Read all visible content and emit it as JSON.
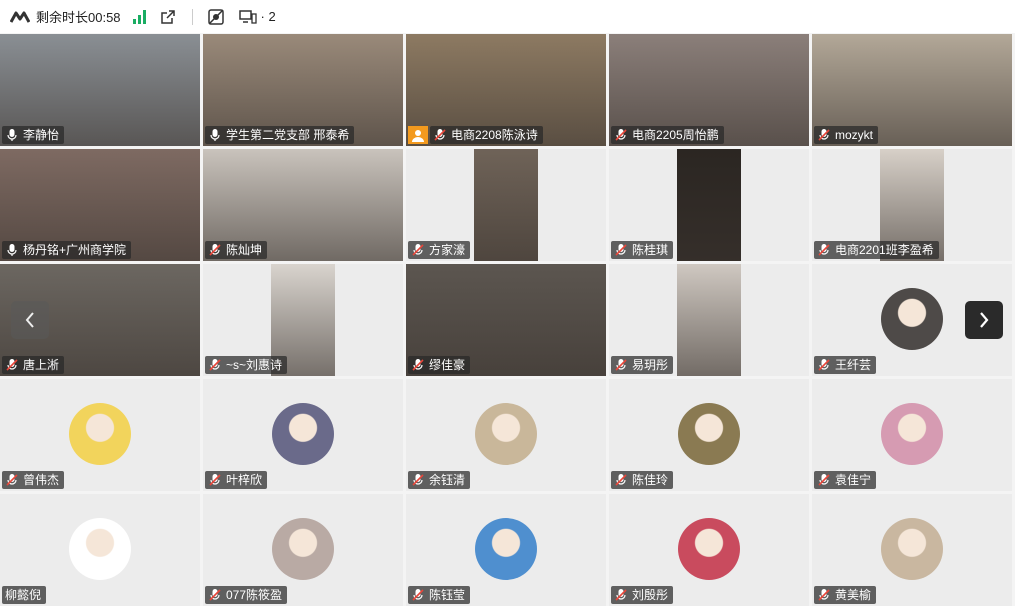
{
  "topbar": {
    "remaining": "剩余时长00:58",
    "device_count": "· 2"
  },
  "participants": [
    {
      "name": "李静怡",
      "mic": "on",
      "kind": "video",
      "bg": "#8a8f94"
    },
    {
      "name": "学生第二党支部 邢泰希",
      "mic": "on",
      "kind": "video",
      "bg": "#9a8a7a"
    },
    {
      "name": "电商2208陈泳诗",
      "mic": "off",
      "kind": "video",
      "bg": "#8d7a62",
      "badge": "host"
    },
    {
      "name": "电商2205周怡鹏",
      "mic": "off",
      "kind": "video",
      "bg": "#8b7f7a"
    },
    {
      "name": "mozykt",
      "mic": "off",
      "kind": "video",
      "bg": "#b3a898"
    },
    {
      "name": "杨丹铭+广州商学院",
      "mic": "on",
      "kind": "video",
      "bg": "#7e6a62"
    },
    {
      "name": "陈灿坤",
      "mic": "off",
      "kind": "video",
      "bg": "#c9c3bc"
    },
    {
      "name": "方家濠",
      "mic": "off",
      "kind": "portrait",
      "bg": "#6f6358"
    },
    {
      "name": "陈桂琪",
      "mic": "off",
      "kind": "portrait",
      "bg": "#2b2622"
    },
    {
      "name": "电商2201班李盈希",
      "mic": "off",
      "kind": "portrait",
      "bg": "#d7d0c8"
    },
    {
      "name": "唐上淅",
      "mic": "off",
      "kind": "video",
      "bg": "#6c6761"
    },
    {
      "name": "~s~刘惠诗",
      "mic": "off",
      "kind": "portrait",
      "bg": "#d9d4ce"
    },
    {
      "name": "缪佳豪",
      "mic": "off",
      "kind": "video",
      "bg": "#5c5650"
    },
    {
      "name": "易玥彤",
      "mic": "off",
      "kind": "portrait",
      "bg": "#cfc8c1"
    },
    {
      "name": "王纤芸",
      "mic": "off",
      "kind": "avatar",
      "bg": "#4e4a48"
    },
    {
      "name": "曾伟杰",
      "mic": "off",
      "kind": "avatar",
      "bg": "#f2d45c"
    },
    {
      "name": "叶梓欣",
      "mic": "off",
      "kind": "avatar",
      "bg": "#6a6a8a"
    },
    {
      "name": "余钰清",
      "mic": "off",
      "kind": "avatar",
      "bg": "#c9b79a"
    },
    {
      "name": "陈佳玲",
      "mic": "off",
      "kind": "avatar",
      "bg": "#8a7a52"
    },
    {
      "name": "袁佳宁",
      "mic": "off",
      "kind": "avatar",
      "bg": "#d69bb2"
    },
    {
      "name": "柳懿倪",
      "mic": "none",
      "kind": "avatar",
      "bg": "#ffffff"
    },
    {
      "name": "077陈筱盈",
      "mic": "off",
      "kind": "avatar",
      "bg": "#b9aaa4"
    },
    {
      "name": "陈钰莹",
      "mic": "off",
      "kind": "avatar",
      "bg": "#4f8fcf"
    },
    {
      "name": "刘殷彤",
      "mic": "off",
      "kind": "avatar",
      "bg": "#c94b5e"
    },
    {
      "name": "黄美榆",
      "mic": "off",
      "kind": "avatar",
      "bg": "#c9b7a0"
    }
  ]
}
